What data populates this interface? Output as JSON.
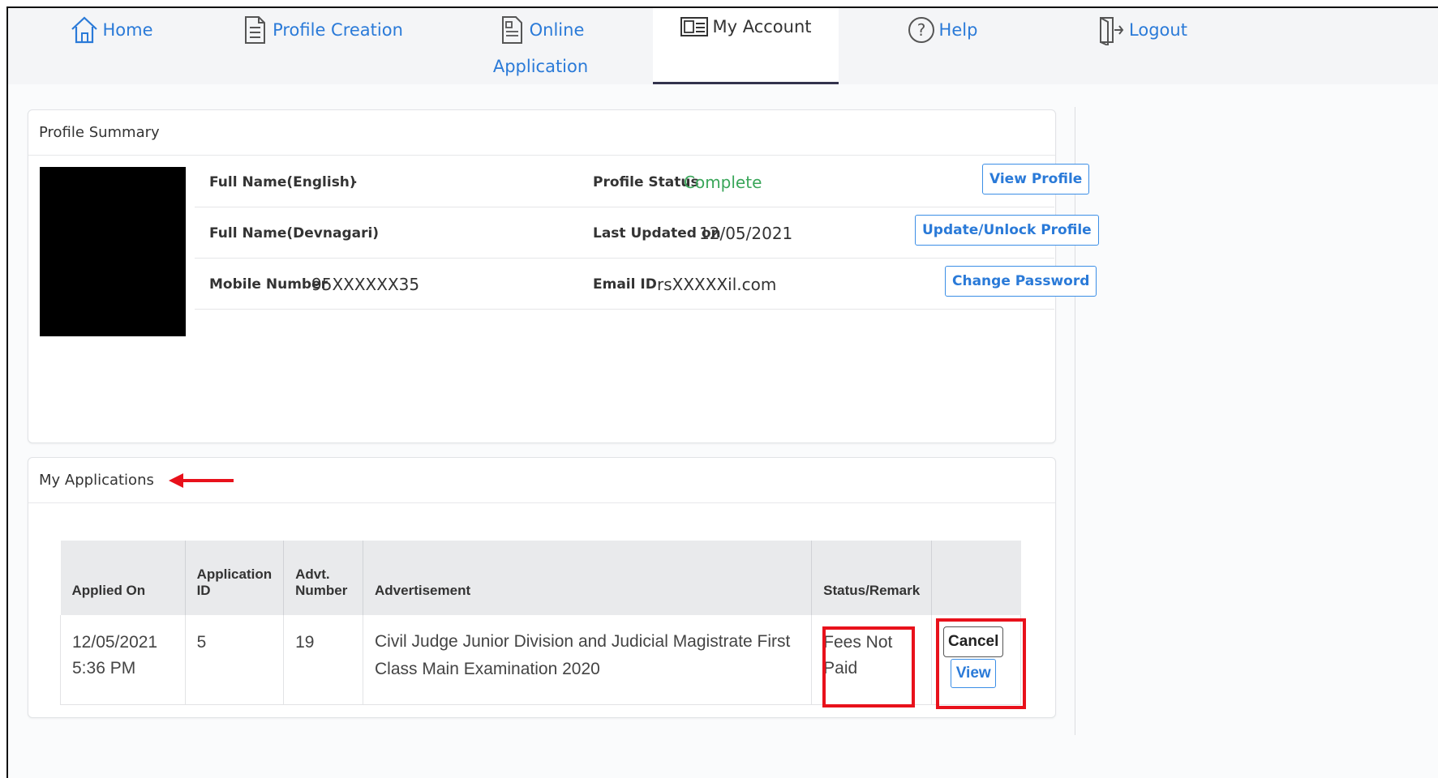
{
  "nav": {
    "home": "Home",
    "profile_creation": "Profile Creation",
    "online_line1": "Online",
    "online_line2": "Application",
    "my_account": "My Account",
    "help": "Help",
    "logout": "Logout"
  },
  "profile": {
    "heading": "Profile Summary",
    "full_name_english_label": "Full Name(English)",
    "full_name_english_value": ".",
    "full_name_devnagari_label": "Full Name(Devnagari)",
    "mobile_label": "Mobile Number",
    "mobile_value": "95XXXXXX35",
    "status_label": "Profile Status",
    "status_value": "Complete",
    "updated_label": "Last Updated on",
    "updated_value": "12/05/2021",
    "email_label": "Email ID",
    "email_value": "rsXXXXXil.com",
    "view_profile": "View Profile",
    "update_unlock": "Update/Unlock Profile",
    "change_password": "Change Password"
  },
  "applications": {
    "heading": "My Applications",
    "columns": {
      "applied_on": "Applied On",
      "application_id_1": "Application",
      "application_id_2": "ID",
      "advt_number_1": "Advt.",
      "advt_number_2": "Number",
      "advertisement": "Advertisement",
      "status": "Status/Remark"
    },
    "rows": [
      {
        "date": "12/05/2021",
        "time": "5:36 PM",
        "application_id": "5",
        "advt_number": "19",
        "advertisement": "Civil Judge Junior Division and Judicial Magistrate First Class Main Examination 2020",
        "status_line1": "Fees Not",
        "status_line2": "Paid",
        "cancel": "Cancel",
        "view": "View"
      }
    ]
  },
  "colors": {
    "link_blue": "#2a7ad8",
    "status_green": "#3aa65a",
    "annotation_red": "#e8111b"
  }
}
